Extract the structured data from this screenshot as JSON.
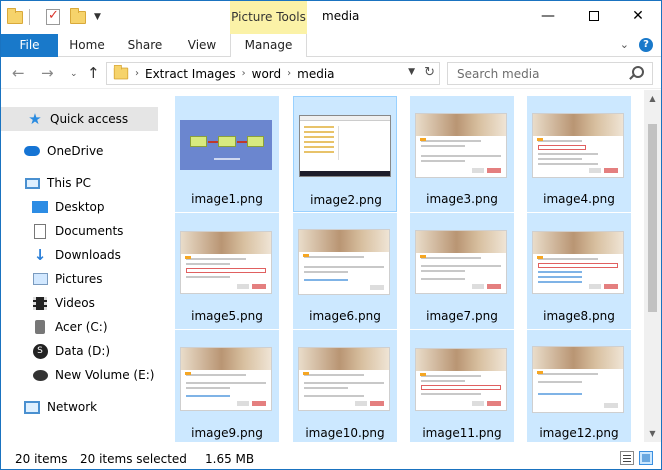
{
  "window": {
    "title": "media",
    "contextual_tab_group": "Picture Tools"
  },
  "ribbon": {
    "tabs": [
      {
        "label": "File"
      },
      {
        "label": "Home"
      },
      {
        "label": "Share"
      },
      {
        "label": "View"
      },
      {
        "label": "Manage"
      }
    ]
  },
  "address": {
    "crumbs": [
      "Extract Images",
      "word",
      "media"
    ],
    "search_placeholder": "Search media"
  },
  "nav_pane": {
    "items": [
      {
        "label": "Quick access",
        "icon": "star-icon",
        "selected": true
      },
      {
        "label": "OneDrive",
        "icon": "cloud-icon"
      },
      {
        "label": "This PC",
        "icon": "computer-icon"
      },
      {
        "label": "Desktop",
        "icon": "desktop-icon"
      },
      {
        "label": "Documents",
        "icon": "documents-icon"
      },
      {
        "label": "Downloads",
        "icon": "download-arrow-icon"
      },
      {
        "label": "Pictures",
        "icon": "pictures-icon"
      },
      {
        "label": "Videos",
        "icon": "film-icon"
      },
      {
        "label": "Acer (C:)",
        "icon": "drive-icon"
      },
      {
        "label": "Data (D:)",
        "icon": "superman-drive-icon"
      },
      {
        "label": "New Volume (E:)",
        "icon": "batman-drive-icon"
      },
      {
        "label": "Network",
        "icon": "network-icon"
      }
    ]
  },
  "files": [
    {
      "name": "image1.png",
      "thumb": "diagram"
    },
    {
      "name": "image2.png",
      "thumb": "explorer",
      "focused": true
    },
    {
      "name": "image3.png",
      "thumb": "dialog"
    },
    {
      "name": "image4.png",
      "thumb": "dialog-boxed"
    },
    {
      "name": "image5.png",
      "thumb": "dialog-boxed"
    },
    {
      "name": "image6.png",
      "thumb": "dialog"
    },
    {
      "name": "image7.png",
      "thumb": "dialog"
    },
    {
      "name": "image8.png",
      "thumb": "dialog-boxed"
    },
    {
      "name": "image9.png",
      "thumb": "dialog"
    },
    {
      "name": "image10.png",
      "thumb": "dialog"
    },
    {
      "name": "image11.png",
      "thumb": "dialog-boxed"
    },
    {
      "name": "image12.png",
      "thumb": "dialog"
    }
  ],
  "status": {
    "item_count": "20 items",
    "selected": "20 items selected",
    "size": "1.65 MB"
  },
  "colors": {
    "accent": "#1979ca",
    "selection": "#cce8ff",
    "contextual": "#fbf2a7"
  }
}
